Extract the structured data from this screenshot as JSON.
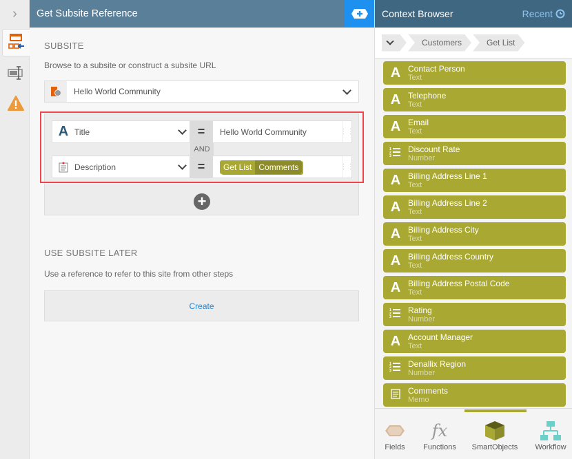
{
  "main": {
    "title": "Get Subsite Reference",
    "subsite_heading": "SUBSITE",
    "subsite_desc": "Browse to a subsite or construct a subsite URL",
    "subsite_value": "Hello World Community",
    "conditions": [
      {
        "field": "Title",
        "value": "Hello World Community"
      },
      {
        "field": "Description",
        "chip_source": "Get List",
        "chip_field": "Comments"
      }
    ],
    "and_label": "AND",
    "later_heading": "USE SUBSITE LATER",
    "later_desc": "Use a reference to refer to this site from other steps",
    "create_label": "Create"
  },
  "context": {
    "title": "Context Browser",
    "recent_label": "Recent",
    "breadcrumbs": [
      "Customers",
      "Get List"
    ],
    "items": [
      {
        "name": "Contact Person",
        "type": "Text",
        "icon": "text-icon"
      },
      {
        "name": "Telephone",
        "type": "Text",
        "icon": "text-icon"
      },
      {
        "name": "Email",
        "type": "Text",
        "icon": "text-icon"
      },
      {
        "name": "Discount Rate",
        "type": "Number",
        "icon": "number-icon"
      },
      {
        "name": "Billing Address Line 1",
        "type": "Text",
        "icon": "text-icon"
      },
      {
        "name": "Billing Address Line 2",
        "type": "Text",
        "icon": "text-icon"
      },
      {
        "name": "Billing Address City",
        "type": "Text",
        "icon": "text-icon"
      },
      {
        "name": "Billing Address Country",
        "type": "Text",
        "icon": "text-icon"
      },
      {
        "name": "Billing Address Postal Code",
        "type": "Text",
        "icon": "text-icon"
      },
      {
        "name": "Rating",
        "type": "Number",
        "icon": "number-icon"
      },
      {
        "name": "Account Manager",
        "type": "Text",
        "icon": "text-icon"
      },
      {
        "name": "Denallix Region",
        "type": "Number",
        "icon": "number-icon"
      },
      {
        "name": "Comments",
        "type": "Memo",
        "icon": "memo-icon"
      }
    ],
    "tabs": [
      "Fields",
      "Functions",
      "SmartObjects",
      "Workflow"
    ],
    "active_tab": "SmartObjects"
  },
  "colors": {
    "accent": "#a9a833",
    "header": "#5a7f98",
    "blue": "#1e90f0"
  }
}
